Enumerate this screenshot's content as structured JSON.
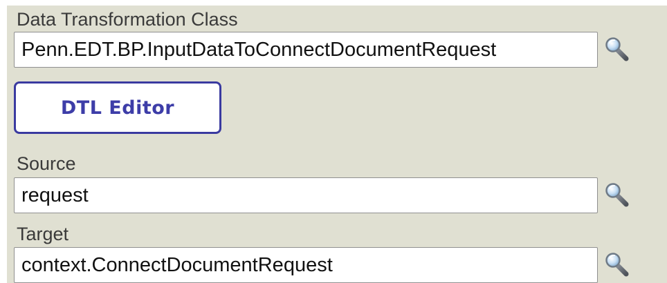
{
  "transform_class": {
    "label": "Data Transformation Class",
    "value": "Penn.EDT.BP.InputDataToConnectDocumentRequest"
  },
  "dtl_editor_button": {
    "label": "DTL Editor"
  },
  "source": {
    "label": "Source",
    "value": "request"
  },
  "target": {
    "label": "Target",
    "value": "context.ConnectDocumentRequest"
  },
  "icons": {
    "search": "magnifier-icon"
  },
  "colors": {
    "panel_background": "#e0e0d2",
    "button_text": "#3d3da8",
    "button_border": "#3a3aa0"
  }
}
